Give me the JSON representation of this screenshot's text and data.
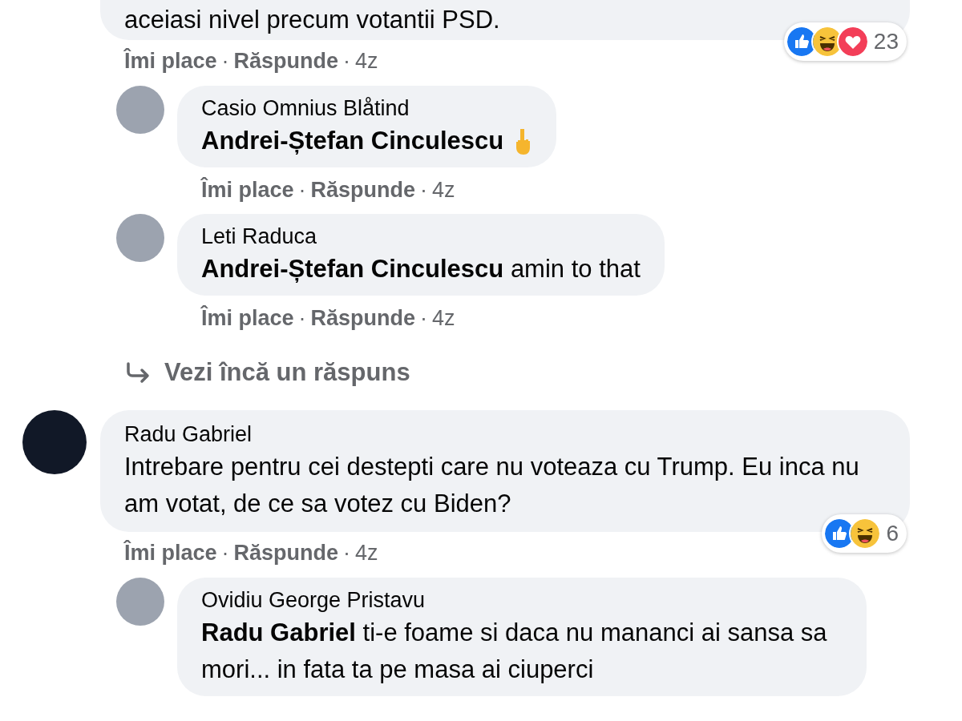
{
  "comments": [
    {
      "text": "aceiasi nivel precum votantii PSD.",
      "actions": [
        {
          "kind": "like",
          "label": "Îmi place"
        },
        {
          "kind": "dot",
          "label": "·"
        },
        {
          "kind": "reply",
          "label": "Răspunde"
        },
        {
          "kind": "dot",
          "label": "·"
        },
        {
          "kind": "time",
          "label": "4z"
        }
      ],
      "reactions": {
        "types": [
          {
            "kind": "like"
          },
          {
            "kind": "haha"
          },
          {
            "kind": "love"
          }
        ],
        "count": "23"
      },
      "replies": [
        {
          "author": "Casio Omnius Blåtind",
          "mention": "Andrei-Ștefan Cinculescu",
          "emoji": {
            "kind": "middle-finger"
          },
          "actions": [
            {
              "kind": "like",
              "label": "Îmi place"
            },
            {
              "kind": "dot",
              "label": "·"
            },
            {
              "kind": "reply",
              "label": "Răspunde"
            },
            {
              "kind": "dot",
              "label": "·"
            },
            {
              "kind": "time",
              "label": "4z"
            }
          ]
        },
        {
          "author": "Leti Raduca",
          "mention": "Andrei-Ștefan Cinculescu",
          "text": "amin to that",
          "actions": [
            {
              "kind": "like",
              "label": "Îmi place"
            },
            {
              "kind": "dot",
              "label": "·"
            },
            {
              "kind": "reply",
              "label": "Răspunde"
            },
            {
              "kind": "dot",
              "label": "·"
            },
            {
              "kind": "time",
              "label": "4z"
            }
          ]
        }
      ],
      "more_replies": "Vezi încă un răspuns"
    },
    {
      "author": "Radu Gabriel",
      "text": "Intrebare pentru cei destepti care nu voteaza cu Trump. Eu inca nu am votat, de ce sa votez cu Biden?",
      "actions": [
        {
          "kind": "like",
          "label": "Îmi place"
        },
        {
          "kind": "dot",
          "label": "·"
        },
        {
          "kind": "reply",
          "label": "Răspunde"
        },
        {
          "kind": "dot",
          "label": "·"
        },
        {
          "kind": "time",
          "label": "4z"
        }
      ],
      "reactions": {
        "types": [
          {
            "kind": "like"
          },
          {
            "kind": "haha"
          }
        ],
        "count": "6"
      },
      "replies": [
        {
          "author": "Ovidiu George Pristavu",
          "mention": "Radu Gabriel",
          "text": "ti-e foame si daca nu mananci ai sansa sa mori... in fata ta pe masa ai ciuperci"
        }
      ]
    }
  ]
}
